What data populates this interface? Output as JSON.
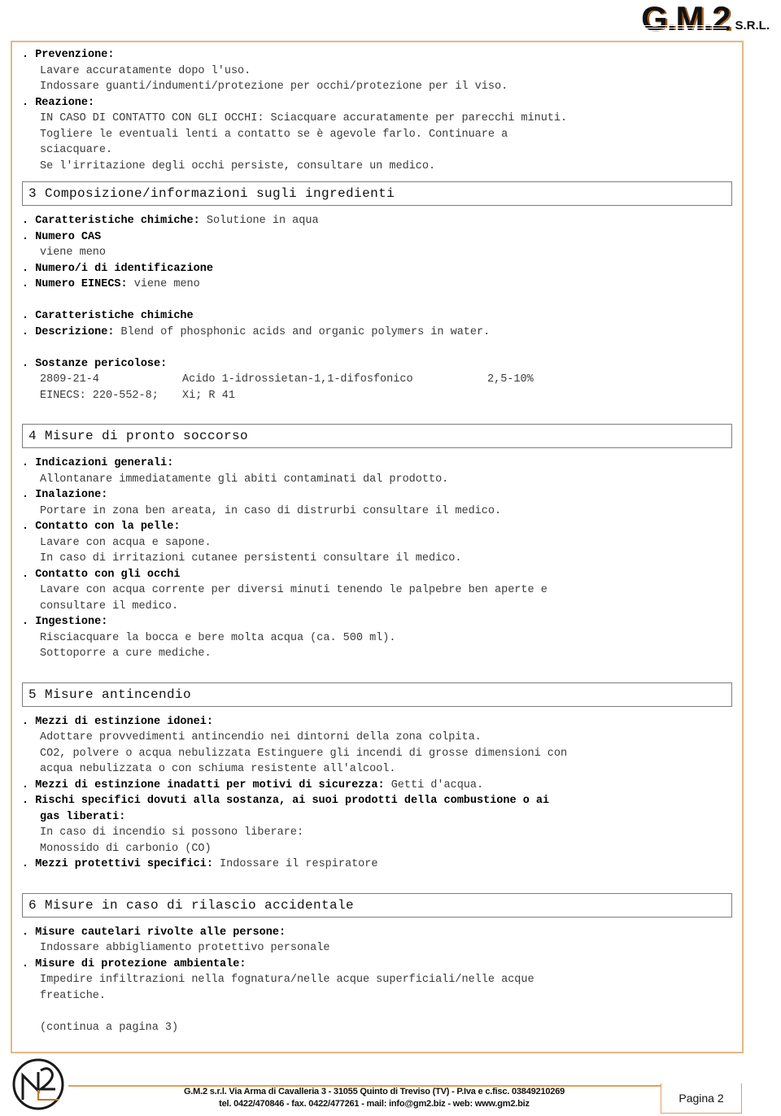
{
  "header": {
    "logo_text": "G.M.2",
    "logo_suffix": "S.R.L."
  },
  "top_block": {
    "items": [
      {
        "bullet": ".",
        "label": "Prevenzione:",
        "value": ""
      },
      {
        "text": "Lavare accuratamente dopo l'uso."
      },
      {
        "text": "Indossare guanti/indumenti/protezione per occhi/protezione per il viso."
      },
      {
        "bullet": ".",
        "label": "Reazione:",
        "value": ""
      },
      {
        "text": "IN CASO DI CONTATTO CON GLI OCCHI: Sciacquare accuratamente per parecchi minuti."
      },
      {
        "text": "Togliere le eventuali lenti a contatto se è agevole farlo. Continuare a"
      },
      {
        "text": "sciacquare."
      },
      {
        "text": "Se l'irritazione degli occhi persiste, consultare un medico."
      }
    ]
  },
  "section3": {
    "heading": "3 Composizione/informazioni sugli ingredienti",
    "lines": [
      {
        "bullet": ".",
        "label": "Caratteristiche chimiche",
        "sep": ": ",
        "value": "Solutione in aqua"
      },
      {
        "bullet": ".",
        "label": "Numero CAS",
        "sep": "",
        "value": ""
      },
      {
        "text": "viene meno"
      },
      {
        "bullet": ".",
        "label": "Numero/i di identificazione",
        "sep": "",
        "value": ""
      },
      {
        "bullet": ".",
        "label": "Numero EINECS",
        "sep": ": ",
        "value": "viene meno"
      },
      {
        "text": ""
      },
      {
        "bullet": ".",
        "label": "Caratteristiche chimiche",
        "sep": "",
        "value": ""
      },
      {
        "bullet": ".",
        "label": "Descrizione",
        "sep": ": ",
        "value": "Blend of phosphonic acids and organic polymers in water."
      },
      {
        "text": ""
      },
      {
        "bullet": ".",
        "label": "Sostanze pericolose:",
        "sep": "",
        "value": ""
      }
    ],
    "hazard_rows": [
      {
        "cas": "2809-21-4",
        "name": "Acido 1-idrossietan-1,1-difosfonico",
        "amount": "2,5-10%"
      },
      {
        "cas": "EINECS: 220-552-8;",
        "name": "Xi; R 41",
        "amount": ""
      }
    ]
  },
  "section4": {
    "heading": "4 Misure di pronto soccorso",
    "lines": [
      {
        "bullet": ".",
        "label": "Indicazioni generali:",
        "sep": "",
        "value": ""
      },
      {
        "text": "Allontanare immediatamente gli abiti contaminati dal prodotto."
      },
      {
        "bullet": ".",
        "label": "Inalazione:",
        "sep": "",
        "value": ""
      },
      {
        "text": "Portare in zona ben areata, in caso di distrurbi consultare il medico."
      },
      {
        "bullet": ".",
        "label": "Contatto con la pelle:",
        "sep": "",
        "value": ""
      },
      {
        "text": "Lavare con acqua e sapone."
      },
      {
        "text": "In caso di irritazioni cutanee persistenti consultare il medico."
      },
      {
        "bullet": ".",
        "label": "Contatto con gli occhi",
        "sep": "",
        "value": ""
      },
      {
        "text": "Lavare con acqua corrente per diversi minuti tenendo le palpebre ben aperte e"
      },
      {
        "text": "consultare il medico."
      },
      {
        "bullet": ".",
        "label": "Ingestione:",
        "sep": "",
        "value": ""
      },
      {
        "text": "Risciacquare la bocca e bere molta acqua (ca. 500 ml)."
      },
      {
        "text": "Sottoporre a cure mediche."
      }
    ]
  },
  "section5": {
    "heading": "5 Misure antincendio",
    "lines": [
      {
        "bullet": ".",
        "label": "Mezzi di estinzione idonei:",
        "sep": "",
        "value": ""
      },
      {
        "text": "Adottare provvedimenti antincendio nei dintorni della zona colpita."
      },
      {
        "text": "CO2, polvere o acqua nebulizzata Estinguere gli incendi di grosse dimensioni con"
      },
      {
        "text": "acqua nebulizzata o con schiuma resistente all'alcool."
      },
      {
        "bullet": ".",
        "label": "Mezzi di estinzione inadatti per motivi di sicurezza",
        "sep": ": ",
        "value": "Getti d'acqua."
      },
      {
        "bullet": ".",
        "label": "Rischi specifici dovuti alla sostanza, ai suoi prodotti della combustione o ai",
        "sep": "",
        "value": ""
      },
      {
        "bold_cont": "gas liberati:"
      },
      {
        "text": "In caso di incendio si possono liberare:"
      },
      {
        "text": "Monossido di carbonio (CO)"
      },
      {
        "bullet": ".",
        "label": "Mezzi protettivi specifici",
        "sep": ": ",
        "value": "Indossare il respiratore"
      }
    ]
  },
  "section6": {
    "heading": "6 Misure in caso di rilascio accidentale",
    "lines": [
      {
        "bullet": ".",
        "label": "Misure cautelari rivolte alle persone",
        "sep": ":",
        "value": ""
      },
      {
        "text": "Indossare abbigliamento protettivo personale"
      },
      {
        "bullet": ".",
        "label": "Misure di protezione ambientale",
        "sep": ":",
        "value": ""
      },
      {
        "text": "Impedire infiltrazioni nella fognatura/nelle acque superficiali/nelle acque"
      },
      {
        "text": "freatiche."
      },
      {
        "text": ""
      },
      {
        "text": "(continua a pagina 3)"
      }
    ]
  },
  "footer": {
    "address_line1": "G.M.2 s.r.l.  Via Arma di Cavalleria 3 - 31055 Quinto di Treviso (TV) - P.Iva e c.fisc. 03849210269",
    "address_line2": "tel. 0422/470846 - fax. 0422/477261 - mail: info@gm2.biz - web: www.gm2.biz",
    "page_label": "Pagina 2"
  },
  "colors": {
    "frame_border": "#e2b887",
    "section_border": "#7d7d7d",
    "footer_accent": "#e2a05a",
    "body_text": "#3a3a3a"
  }
}
